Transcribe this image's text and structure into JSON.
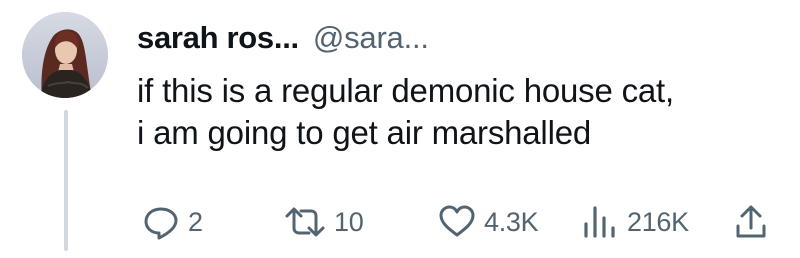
{
  "author": {
    "display_name": "sarah ros...",
    "handle": "@sara..."
  },
  "tweet": {
    "lines": [
      "if this is a regular demonic house cat,",
      "i am going to get air marshalled"
    ]
  },
  "actions": {
    "reply": {
      "icon": "reply-icon",
      "count": "2"
    },
    "retweet": {
      "icon": "retweet-icon",
      "count": "10"
    },
    "like": {
      "icon": "heart-icon",
      "count": "4.3K"
    },
    "views": {
      "icon": "views-icon",
      "count": "216K"
    },
    "share": {
      "icon": "share-icon"
    }
  },
  "colors": {
    "text": "#0f1419",
    "secondary": "#536471",
    "thread_line": "#cfd9de"
  }
}
